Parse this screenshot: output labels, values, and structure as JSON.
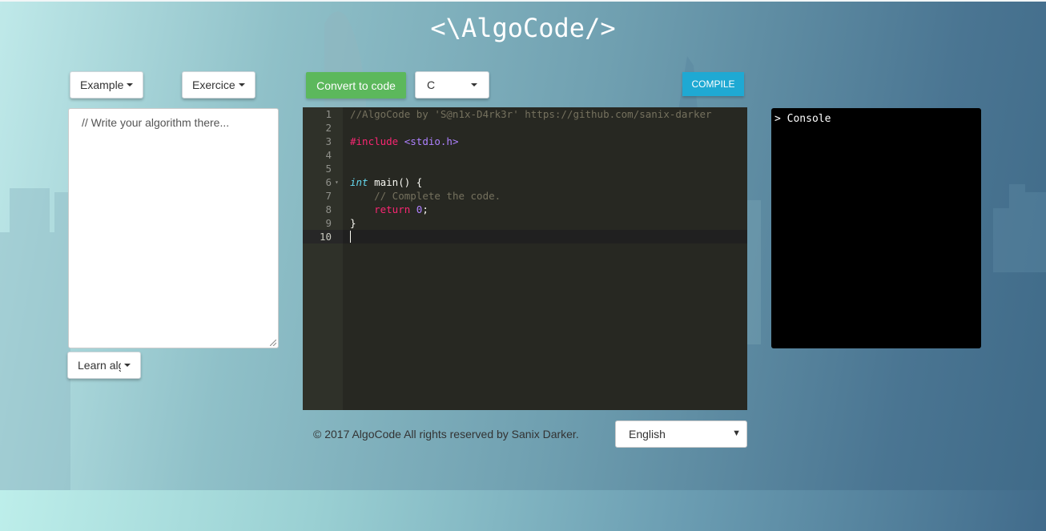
{
  "app": {
    "title": "<\\AlgoCode/>"
  },
  "toolbar": {
    "example_label": "Example",
    "exercice_label": "Exercice",
    "convert_label": "Convert to code",
    "language_selected": "C",
    "compile_label": "COMPILE",
    "learn_label": "Learn algorithm"
  },
  "algo_input": {
    "placeholder": "// Write your algorithm there..."
  },
  "editor": {
    "line_numbers": [
      "1",
      "2",
      "3",
      "4",
      "5",
      "6",
      "7",
      "8",
      "9",
      "10"
    ],
    "lines": {
      "l1": "//AlgoCode by 'S@n1x-D4rk3r' https://github.com/sanix-darker",
      "l3_directive": "#include",
      "l3_lib": "<stdio.h>",
      "l6_type": "int",
      "l6_rest": "main() {",
      "l7": "// Complete the code.",
      "l8_kw": "return",
      "l8_num": "0",
      "l8_end": ";",
      "l9": "}"
    }
  },
  "console": {
    "text": "> Console"
  },
  "footer": {
    "copyright": "© 2017 AlgoCode All rights reserved by Sanix Darker.",
    "ui_language": "English"
  },
  "colors": {
    "convert_button": "#5cb85c",
    "compile_button": "#1fa9d3",
    "editor_bg": "#272822",
    "console_bg": "#000000"
  }
}
